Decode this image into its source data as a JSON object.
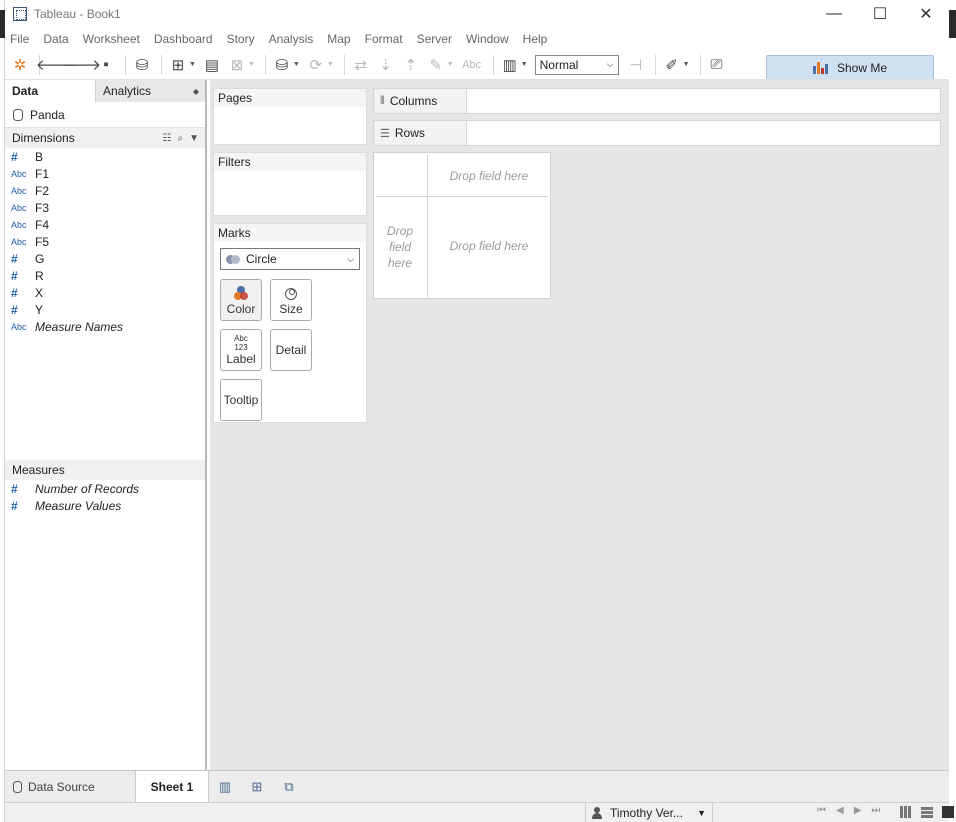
{
  "window": {
    "title": "Tableau - Book1",
    "minimize": "—",
    "maximize": "☐",
    "close": "✕"
  },
  "menu": [
    "File",
    "Data",
    "Worksheet",
    "Dashboard",
    "Story",
    "Analysis",
    "Map",
    "Format",
    "Server",
    "Window",
    "Help"
  ],
  "toolbar": {
    "fit_value": "Normal",
    "show_me_label": "Show Me",
    "text_tool_label": "Abc"
  },
  "left_pane": {
    "tab_data": "Data",
    "tab_analytics": "Analytics",
    "datasource": "Panda",
    "dimensions_label": "Dimensions",
    "dimensions": [
      {
        "type": "num",
        "name": "B"
      },
      {
        "type": "Abc",
        "name": "F1"
      },
      {
        "type": "Abc",
        "name": "F2"
      },
      {
        "type": "Abc",
        "name": "F3"
      },
      {
        "type": "Abc",
        "name": "F4"
      },
      {
        "type": "Abc",
        "name": "F5"
      },
      {
        "type": "num",
        "name": "G"
      },
      {
        "type": "num",
        "name": "R"
      },
      {
        "type": "num",
        "name": "X"
      },
      {
        "type": "num",
        "name": "Y"
      },
      {
        "type": "Abc",
        "name": "Measure Names"
      }
    ],
    "measures_label": "Measures",
    "measures": [
      {
        "type": "num",
        "name": "Number of Records"
      },
      {
        "type": "num",
        "name": "Measure Values"
      }
    ]
  },
  "cards": {
    "pages": "Pages",
    "filters": "Filters",
    "marks": "Marks",
    "mark_type": "Circle",
    "mark_buttons": [
      "Color",
      "Size",
      "Label",
      "Detail",
      "Tooltip"
    ],
    "label_icon_top": "Abc",
    "label_icon_bottom": "123"
  },
  "shelves": {
    "columns": "Columns",
    "rows": "Rows"
  },
  "viz": {
    "drop_top": "Drop field here",
    "drop_left": "Drop field here",
    "drop_center": "Drop field here"
  },
  "bottom": {
    "data_source_tab": "Data Source",
    "sheet_tab": "Sheet 1",
    "user": "Timothy Ver..."
  },
  "colors": {
    "accent": "#1f5fa8",
    "show_me_bg": "#cfe0f0",
    "workspace": "#e6e6e6",
    "color_icon_orange": "#e07b2a",
    "color_icon_blue": "#4a6fa5"
  }
}
